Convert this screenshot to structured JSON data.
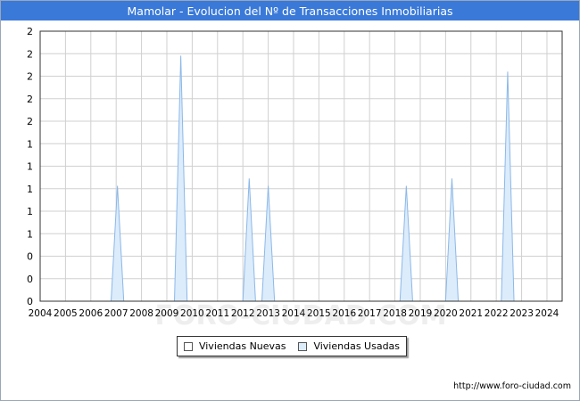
{
  "header": {
    "title": "Mamolar - Evolucion del Nº de Transacciones Inmobiliarias"
  },
  "watermark": "FORO-CIUDAD.COM",
  "source": "http://www.foro-ciudad.com",
  "colors": {
    "title_bar": "#3a79d8",
    "nuevas_fill": "#ffffff",
    "usadas_fill": "#dcecfb",
    "usadas_stroke": "#8cb8e8",
    "grid": "#d0d0d0"
  },
  "chart_data": {
    "type": "area",
    "title": "Mamolar - Evolucion del Nº de Transacciones Inmobiliarias",
    "xlabel": "",
    "ylabel": "",
    "x_ticks": [
      "2004",
      "2005",
      "2006",
      "2007",
      "2008",
      "2009",
      "2010",
      "2011",
      "2012",
      "2013",
      "2014",
      "2015",
      "2016",
      "2017",
      "2018",
      "2019",
      "2020",
      "2021",
      "2022",
      "2023",
      "2024"
    ],
    "y_ticks": [
      "0",
      "0",
      "0",
      "1",
      "1",
      "1",
      "1",
      "1",
      "2",
      "2",
      "2",
      "2"
    ],
    "xlim": [
      2004,
      2024.6
    ],
    "ylim": [
      0,
      2.2
    ],
    "grid": true,
    "legend_position": "bottom-center",
    "series": [
      {
        "name": "Viviendas Nuevas",
        "x": [
          2004,
          2024.6
        ],
        "y": [
          0,
          0
        ]
      },
      {
        "name": "Viviendas Usadas",
        "x": [
          2004,
          2006.8,
          2007.05,
          2007.3,
          2009.3,
          2009.55,
          2009.8,
          2012,
          2012.25,
          2012.5,
          2012.75,
          2013,
          2013.25,
          2018.2,
          2018.45,
          2018.7,
          2020,
          2020.25,
          2020.5,
          2022.2,
          2022.45,
          2022.7,
          2024.6
        ],
        "y": [
          0,
          0,
          0.94,
          0,
          0,
          2,
          0,
          0,
          1,
          0,
          0,
          0.94,
          0,
          0,
          0.94,
          0,
          0,
          1,
          0,
          0,
          1.87,
          0,
          0
        ]
      }
    ]
  }
}
